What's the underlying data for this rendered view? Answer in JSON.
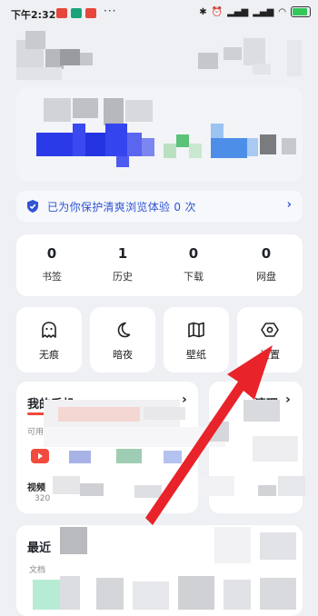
{
  "status_bar": {
    "time": "下午2:32",
    "dots": "···",
    "right_icons": [
      "bluetooth-icon",
      "alarm-icon",
      "signal-icon",
      "signal-icon",
      "wifi-icon",
      "battery-icon"
    ],
    "battery_level": "80"
  },
  "protect_banner": {
    "text": "已为你保护清爽浏览体验 0 次",
    "chevron": "›"
  },
  "stats": [
    {
      "value": "0",
      "label": "书签"
    },
    {
      "value": "1",
      "label": "历史"
    },
    {
      "value": "0",
      "label": "下载"
    },
    {
      "value": "0",
      "label": "网盘"
    }
  ],
  "quick_tiles": [
    {
      "label": "无痕",
      "icon": "ghost-icon"
    },
    {
      "label": "暗夜",
      "icon": "moon-icon"
    },
    {
      "label": "壁纸",
      "icon": "map-book-icon"
    },
    {
      "label": "设置",
      "icon": "hexagon-settings-icon"
    }
  ],
  "phone_card": {
    "title": "我的手机",
    "chevron": "›",
    "subtitle": "可用",
    "item_label": "视频",
    "item_size": "320"
  },
  "clean_card": {
    "title": "清理",
    "chevron": "›"
  },
  "recent_card": {
    "title": "最近",
    "subtitle": "文档"
  },
  "colors": {
    "accent_blue": "#2f55d4",
    "arrow_red": "#e8232a",
    "brand_red": "#f04b3c"
  }
}
